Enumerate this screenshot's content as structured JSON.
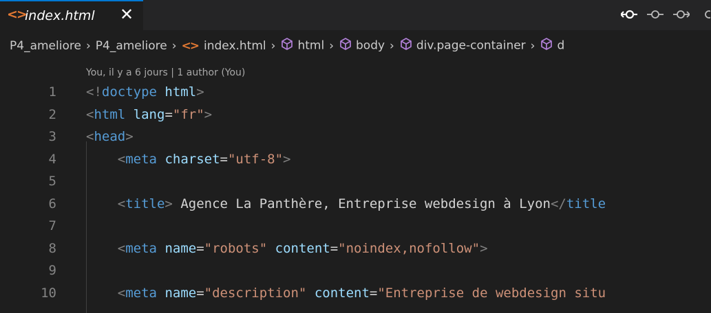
{
  "tab": {
    "icon": "html-file-icon",
    "label": "index.html",
    "close_glyph": "✕"
  },
  "editor_actions": [
    {
      "name": "go-back-change-icon"
    },
    {
      "name": "open-changes-icon"
    },
    {
      "name": "go-forward-change-icon"
    }
  ],
  "breadcrumb": {
    "items": [
      {
        "label": "P4_ameliore",
        "icon": ""
      },
      {
        "label": "P4_ameliore",
        "icon": ""
      },
      {
        "label": "index.html",
        "icon": "html-file-icon"
      },
      {
        "label": "html",
        "icon": "symbol-cube-icon"
      },
      {
        "label": "body",
        "icon": "symbol-cube-icon"
      },
      {
        "label": "div.page-container",
        "icon": "symbol-cube-icon"
      },
      {
        "label": "d",
        "icon": "symbol-cube-icon"
      }
    ],
    "separator": "›"
  },
  "blame": "You, il y a 6 jours | 1 author (You)",
  "colors": {
    "tab_accent": "#0078d4",
    "file_icon": "#e37933",
    "punctuation": "#808080",
    "tag": "#569cd6",
    "attribute": "#9cdcfe",
    "string": "#ce9178",
    "text": "#d4d4d4",
    "line_number": "#858585"
  },
  "code_lines": [
    {
      "n": "1",
      "tokens": [
        [
          "punct",
          "<!"
        ],
        [
          "tag",
          "doctype"
        ],
        [
          "text",
          " "
        ],
        [
          "attr",
          "html"
        ],
        [
          "punct",
          ">"
        ]
      ]
    },
    {
      "n": "2",
      "tokens": [
        [
          "punct",
          "<"
        ],
        [
          "tag",
          "html"
        ],
        [
          "text",
          " "
        ],
        [
          "attr",
          "lang"
        ],
        [
          "text",
          "="
        ],
        [
          "str",
          "\"fr\""
        ],
        [
          "punct",
          ">"
        ]
      ]
    },
    {
      "n": "3",
      "tokens": [
        [
          "punct",
          "<"
        ],
        [
          "tag",
          "head"
        ],
        [
          "punct",
          ">"
        ]
      ]
    },
    {
      "n": "4",
      "tokens": [
        [
          "text",
          "    "
        ],
        [
          "punct",
          "<"
        ],
        [
          "tag",
          "meta"
        ],
        [
          "text",
          " "
        ],
        [
          "attr",
          "charset"
        ],
        [
          "text",
          "="
        ],
        [
          "str",
          "\"utf-8\""
        ],
        [
          "punct",
          ">"
        ]
      ]
    },
    {
      "n": "5",
      "tokens": []
    },
    {
      "n": "6",
      "tokens": [
        [
          "text",
          "    "
        ],
        [
          "punct",
          "<"
        ],
        [
          "tag",
          "title"
        ],
        [
          "punct",
          ">"
        ],
        [
          "text",
          " Agence La Panthère, Entreprise webdesign à Lyon"
        ],
        [
          "punct",
          "</"
        ],
        [
          "tag",
          "title"
        ]
      ]
    },
    {
      "n": "7",
      "tokens": []
    },
    {
      "n": "8",
      "tokens": [
        [
          "text",
          "    "
        ],
        [
          "punct",
          "<"
        ],
        [
          "tag",
          "meta"
        ],
        [
          "text",
          " "
        ],
        [
          "attr",
          "name"
        ],
        [
          "text",
          "="
        ],
        [
          "str",
          "\"robots\""
        ],
        [
          "text",
          " "
        ],
        [
          "attr",
          "content"
        ],
        [
          "text",
          "="
        ],
        [
          "str",
          "\"noindex,nofollow\""
        ],
        [
          "punct",
          ">"
        ]
      ]
    },
    {
      "n": "9",
      "tokens": []
    },
    {
      "n": "10",
      "tokens": [
        [
          "text",
          "    "
        ],
        [
          "punct",
          "<"
        ],
        [
          "tag",
          "meta"
        ],
        [
          "text",
          " "
        ],
        [
          "attr",
          "name"
        ],
        [
          "text",
          "="
        ],
        [
          "str",
          "\"description\""
        ],
        [
          "text",
          " "
        ],
        [
          "attr",
          "content"
        ],
        [
          "text",
          "="
        ],
        [
          "str",
          "\"Entreprise de webdesign situ"
        ]
      ]
    }
  ]
}
